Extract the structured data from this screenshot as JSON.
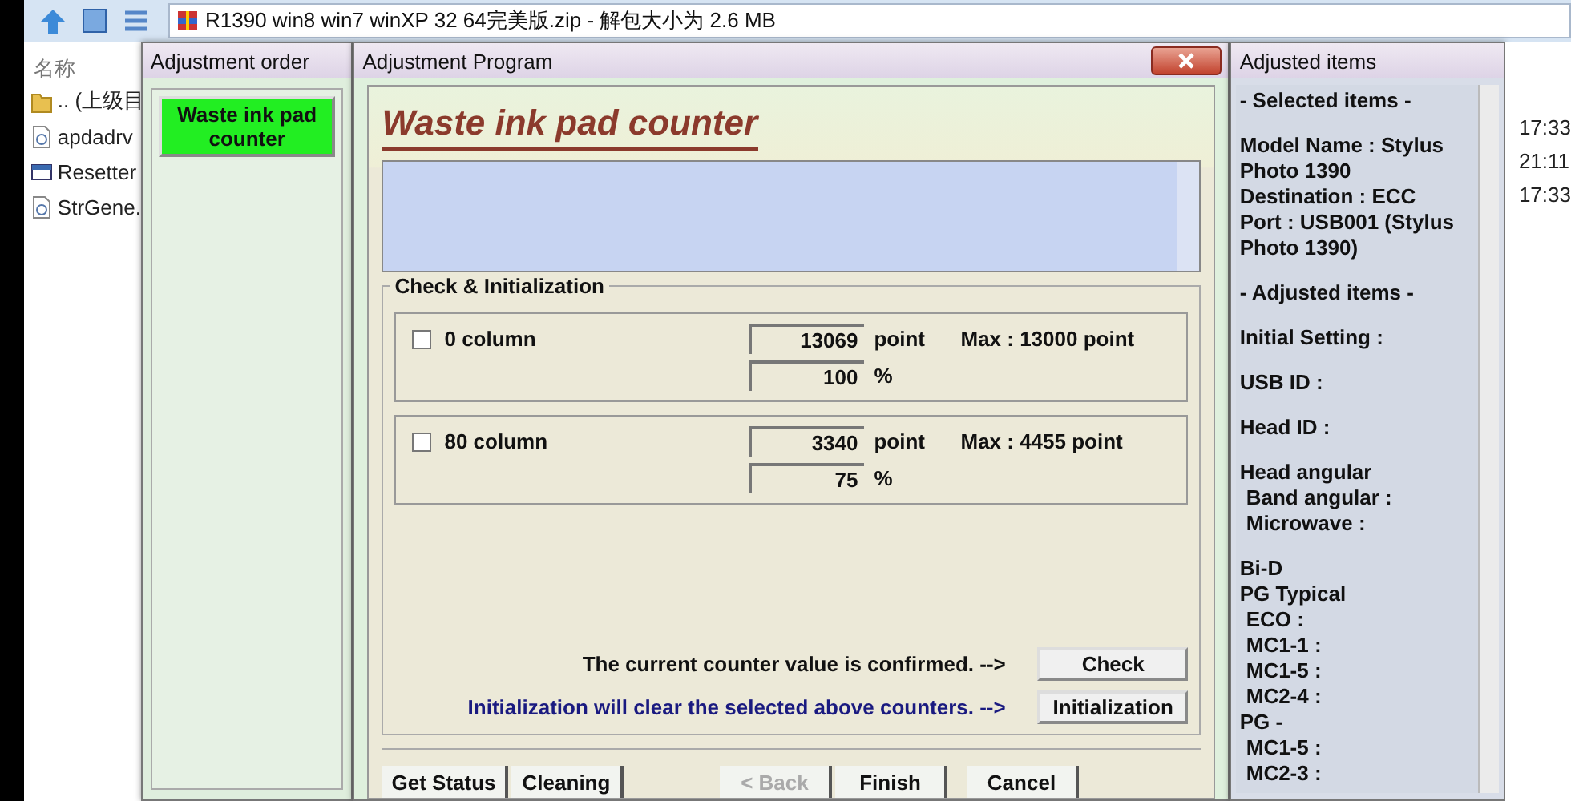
{
  "explorer": {
    "path": "R1390 win8 win7 winXP 32 64完美版.zip - 解包大小为 2.6 MB",
    "column_header": "名称",
    "files": [
      {
        "name": ".. (上级目",
        "kind": "folder"
      },
      {
        "name": "apdadrv",
        "kind": "setup"
      },
      {
        "name": "Resetter",
        "kind": "app"
      },
      {
        "name": "StrGene.",
        "kind": "setup"
      }
    ],
    "times": [
      "17:33",
      "21:11",
      "17:33"
    ]
  },
  "order_window": {
    "title": "Adjustment order",
    "items": [
      {
        "label": "Waste ink pad counter",
        "selected": true
      }
    ]
  },
  "program_window": {
    "title": "Adjustment Program",
    "heading": "Waste ink pad counter",
    "group_title": "Check & Initialization",
    "counters": [
      {
        "label": "0 column",
        "checked": false,
        "points": "13069",
        "point_unit": "point",
        "percent": "100",
        "percent_unit": "%",
        "max": "Max : 13000 point"
      },
      {
        "label": "80 column",
        "checked": false,
        "points": "3340",
        "point_unit": "point",
        "percent": "75",
        "percent_unit": "%",
        "max": "Max : 4455 point"
      }
    ],
    "check_text": "The current counter value is confirmed. -->",
    "check_button": "Check",
    "init_text": "Initialization will clear the selected above counters. -->",
    "init_button": "Initialization",
    "buttons": [
      {
        "label": "Get Status",
        "disabled": false
      },
      {
        "label": "Cleaning",
        "disabled": false
      },
      {
        "label": "< Back",
        "disabled": true
      },
      {
        "label": "Finish",
        "disabled": false
      },
      {
        "label": "Cancel",
        "disabled": false
      }
    ]
  },
  "adjusted_window": {
    "title": "Adjusted items",
    "paragraphs": [
      [
        {
          "text": "- Selected items -",
          "indented": false
        }
      ],
      [
        {
          "text": "Model Name : Stylus Photo 1390",
          "indented": false
        },
        {
          "text": "Destination : ECC",
          "indented": false
        },
        {
          "text": "Port : USB001 (Stylus Photo 1390)",
          "indented": false
        }
      ],
      [
        {
          "text": "- Adjusted items -",
          "indented": false
        }
      ],
      [
        {
          "text": "Initial Setting :",
          "indented": false
        }
      ],
      [
        {
          "text": "USB ID :",
          "indented": false
        }
      ],
      [
        {
          "text": "Head ID :",
          "indented": false
        }
      ],
      [
        {
          "text": "Head angular",
          "indented": false
        },
        {
          "text": "Band angular :",
          "indented": true
        },
        {
          "text": "Microwave :",
          "indented": true
        }
      ],
      [
        {
          "text": "Bi-D",
          "indented": false
        },
        {
          "text": "PG Typical",
          "indented": false
        },
        {
          "text": "ECO   :",
          "indented": true
        },
        {
          "text": "MC1-1 :",
          "indented": true
        },
        {
          "text": "MC1-5 :",
          "indented": true
        },
        {
          "text": "MC2-4 :",
          "indented": true
        },
        {
          "text": "PG -",
          "indented": false
        },
        {
          "text": "MC1-5 :",
          "indented": true
        },
        {
          "text": "MC2-3 :",
          "indented": true
        }
      ]
    ]
  }
}
